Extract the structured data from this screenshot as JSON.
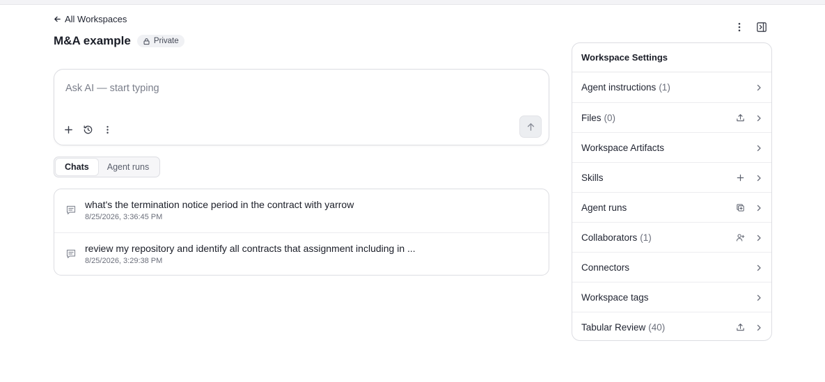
{
  "nav": {
    "back_label": "All Workspaces"
  },
  "workspace": {
    "title": "M&A example",
    "privacy_badge": "Private"
  },
  "prompt": {
    "placeholder": "Ask AI — start typing",
    "value": ""
  },
  "tabs": [
    {
      "label": "Chats",
      "active": true
    },
    {
      "label": "Agent runs",
      "active": false
    }
  ],
  "chats": [
    {
      "title": "what's the termination notice period in the contract with yarrow",
      "timestamp": "8/25/2026, 3:36:45 PM"
    },
    {
      "title": "review my repository and identify all contracts that assignment including in ...",
      "timestamp": "8/25/2026, 3:29:38 PM"
    }
  ],
  "settings": {
    "header": "Workspace Settings",
    "items": [
      {
        "label": "Agent instructions",
        "count": "(1)",
        "action_icon": ""
      },
      {
        "label": "Files",
        "count": "(0)",
        "action_icon": "upload-icon"
      },
      {
        "label": "Workspace Artifacts",
        "count": "",
        "action_icon": ""
      },
      {
        "label": "Skills",
        "count": "",
        "action_icon": "plus-icon"
      },
      {
        "label": "Agent runs",
        "count": "",
        "action_icon": "add-copy-icon"
      },
      {
        "label": "Collaborators",
        "count": "(1)",
        "action_icon": "add-user-icon"
      },
      {
        "label": "Connectors",
        "count": "",
        "action_icon": ""
      },
      {
        "label": "Workspace tags",
        "count": "",
        "action_icon": ""
      },
      {
        "label": "Tabular Review",
        "count": "(40)",
        "action_icon": "upload-icon"
      }
    ]
  },
  "colors": {
    "text": "#1f2330",
    "muted": "#6b6f7b",
    "border": "#dcdde2",
    "badge_bg": "#f0f1f4"
  }
}
